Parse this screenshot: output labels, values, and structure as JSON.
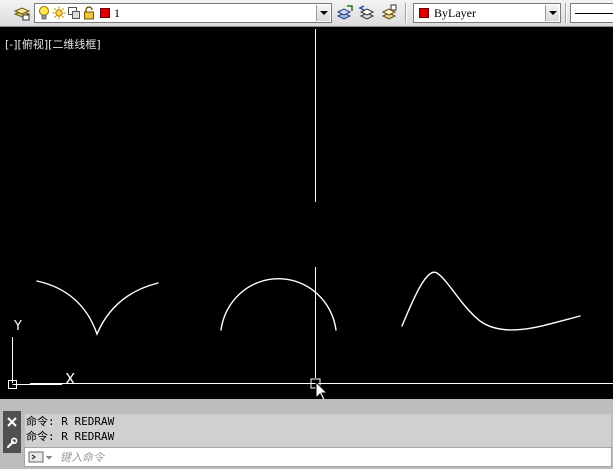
{
  "toolbar": {
    "layer_combo": {
      "value": "1",
      "swatch_color": "#e00000"
    },
    "color_combo": {
      "value": "ByLayer",
      "swatch_color": "#e00000"
    },
    "icons": [
      "layer-manager-icon",
      "lightbulb-on-icon",
      "sun-freeze-icon",
      "viewport-freeze-icon",
      "padlock-icon",
      "make-current-icon",
      "layer-previous-icon",
      "layer-state-icon"
    ]
  },
  "viewport": {
    "label": "[-][俯视][二维线框]",
    "ucs_x_label": "X",
    "ucs_y_label": "Y"
  },
  "command": {
    "history": [
      "命令: R REDRAW",
      "命令: R REDRAW"
    ],
    "input_placeholder": "键入命令",
    "input_value": ""
  },
  "colors": {
    "background": "#000000",
    "geometry": "#ffffff",
    "accent_red": "#e00000",
    "panel": "#bdbdbd"
  }
}
